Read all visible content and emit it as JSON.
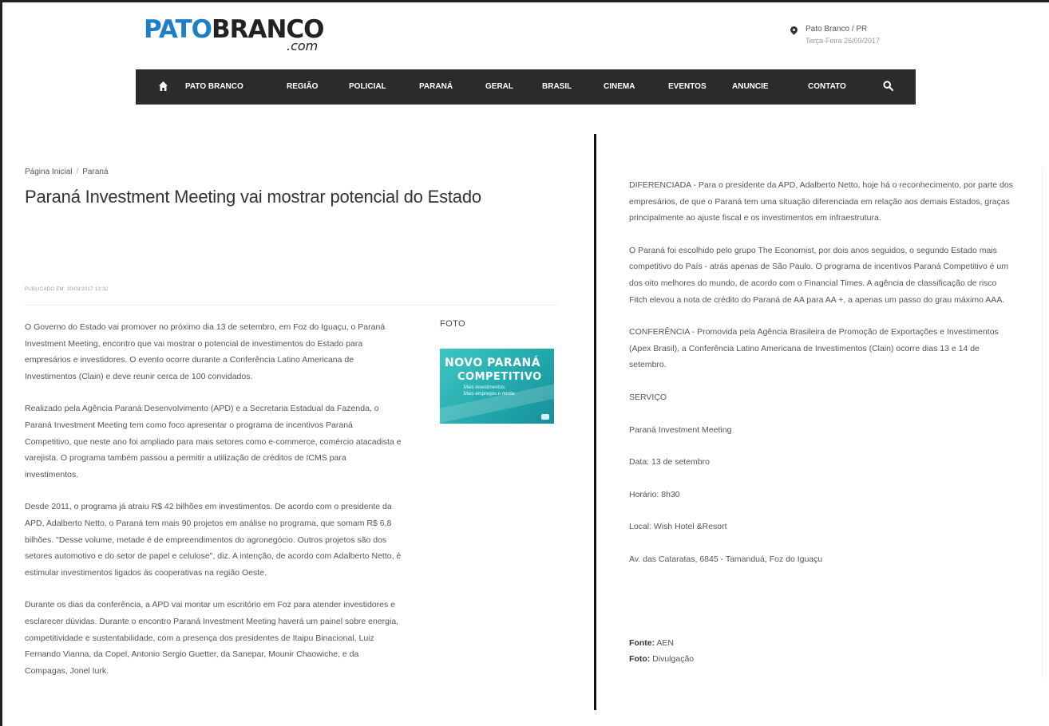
{
  "site": {
    "logo_part1": "PATO",
    "logo_part2": "BRANCO",
    "logo_suffix": ".com",
    "location": "Pato Branco / PR",
    "date": "Terça-Feira 26/09/2017",
    "brand_color": "#1e7fc8"
  },
  "nav": {
    "home_icon": "home-icon",
    "items": [
      "PATO BRANCO",
      "REGIÃO",
      "POLICIAL",
      "PARANÁ",
      "GERAL",
      "BRASIL",
      "CINEMA",
      "EVENTOS",
      "ANUNCIE",
      "CONTATO"
    ],
    "search_icon": "search-icon"
  },
  "breadcrumb": {
    "home": "Página Inicial",
    "separator": "/",
    "current": "Paraná"
  },
  "article": {
    "title": "Paraná Investment Meeting vai mostrar potencial do Estado",
    "published": "Publicado em: 30/08/2017 13:32",
    "foto_label": "FOTO",
    "image": {
      "line1": "NOVO PARANÁ",
      "line2": "COMPETITIVO",
      "line3": "Mais investimentos.",
      "line4": "Mais empregos e renda."
    },
    "left_paragraphs": [
      "O Governo do Estado vai promover no próximo dia 13 de setembro, em Foz do Iguaçu, o Paraná Investment Meeting, encontro que vai mostrar o potencial de investimentos do Estado para empresários e investidores. O evento ocorre durante a Conferência Latino Americana de Investimentos (Clain) e deve reunir cerca de 100 convidados.",
      "Realizado pela Agência Paraná Desenvolvimento (APD) e a Secretaria Estadual da Fazenda, o Paraná Investment Meeting tem como foco apresentar o programa de incentivos Paraná Competitivo, que neste ano foi ampliado para mais setores como e-commerce, comércio atacadista e varejista. O programa também passou a permitir a utilização de créditos de ICMS para investimentos.",
      "Desde 2011, o programa já atraiu R$ 42 bilhões em investimentos. De acordo com o presidente da APD, Adalberto Netto, o Paraná tem mais 90 projetos em análise no programa, que somam R$ 6,8 bilhões. \"Desse volume, metade é de empreendimentos do agronegócio. Outros projetos são dos setores automotivo e do setor de papel e celulose\", diz. A intenção, de acordo com Adalberto Netto, é estimular investimentos ligados às cooperativas na região Oeste.",
      "Durante os dias da conferência, a APD vai montar um escritório em Foz para atender investidores e esclarecer dúvidas. Durante o encontro Paraná Investment Meeting haverá um painel sobre energia, competitividade e sustentabilidade, com a presença dos presidentes de Itaipu Binacional, Luiz Fernando Vianna, da Copel, Antonio Sergio Guetter, da Sanepar, Mounir Chaowiche, e da Compagas, Jonel Iurk."
    ],
    "right_paragraphs": [
      "DIFERENCIADA - Para o presidente da APD, Adalberto Netto, hoje há o reconhecimento, por parte dos empresários, de que o Paraná tem uma situação diferenciada em relação aos demais Estados, graças principalmente ao ajuste fiscal e os investimentos em infraestrutura.",
      "O Paraná foi escolhido pelo grupo The Economist, por dois anos seguidos, o segundo Estado mais competitivo do País - atrás apenas de São Paulo. O programa de incentivos Paraná Competitivo é um dos oito melhores do mundo, de acordo com o Financial Times. A agência de classificação de risco Fitch elevou a nota de crédito do Paraná de AA para AA +, a apenas um passo do grau máximo AAA.",
      "CONFERÊNCIA - Promovida pela Agência Brasileira de Promoção de Exportações e Investimentos (Apex Brasil), a Conferência Latino Americana de Investimentos (Clain) ocorre dias 13 e 14 de setembro.",
      "SERVIÇO",
      "Paraná Investment Meeting",
      "Data: 13 de setembro",
      "Horário: 8h30",
      "Local: Wish Hotel &Resort",
      "Av. das Cataratas, 6845 - Tamanduá, Foz do Iguaçu"
    ],
    "source_label": "Fonte:",
    "source_value": "AEN",
    "photo_label": "Foto:",
    "photo_value": "Divulgação"
  }
}
